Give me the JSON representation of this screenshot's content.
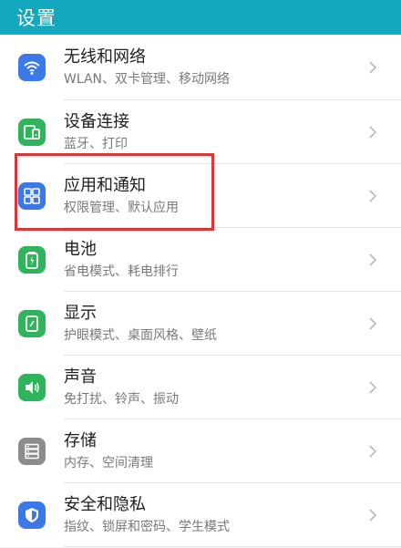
{
  "header": {
    "title": "设置"
  },
  "items": [
    {
      "title": "无线和网络",
      "subtitle": "WLAN、双卡管理、移动网络",
      "icon": "wifi-icon",
      "color": "#3b79e8"
    },
    {
      "title": "设备连接",
      "subtitle": "蓝牙、打印",
      "icon": "device-connection-icon",
      "color": "#2fb45b"
    },
    {
      "title": "应用和通知",
      "subtitle": "权限管理、默认应用",
      "icon": "apps-icon",
      "color": "#3b79e8"
    },
    {
      "title": "电池",
      "subtitle": "省电模式、耗电排行",
      "icon": "battery-icon",
      "color": "#2fb45b"
    },
    {
      "title": "显示",
      "subtitle": "护眼模式、桌面风格、壁纸",
      "icon": "display-icon",
      "color": "#2fb45b"
    },
    {
      "title": "声音",
      "subtitle": "免打扰、铃声、振动",
      "icon": "sound-icon",
      "color": "#2fb45b"
    },
    {
      "title": "存储",
      "subtitle": "内存、空间清理",
      "icon": "storage-icon",
      "color": "#8c8c8c"
    },
    {
      "title": "安全和隐私",
      "subtitle": "指纹、锁屏和密码、学生模式",
      "icon": "security-shield-icon",
      "color": "#3b79e8"
    }
  ],
  "highlight": {
    "color": "#d9383a",
    "target": "应用和通知"
  }
}
